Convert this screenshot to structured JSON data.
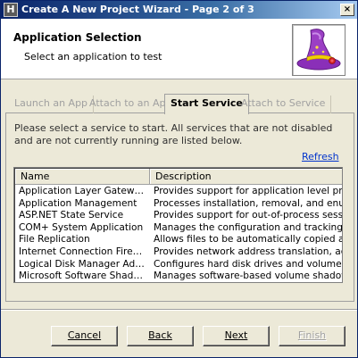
{
  "window": {
    "title": "Create A New Project Wizard - Page 2 of 3",
    "app_icon": "H",
    "close_label": "×"
  },
  "header": {
    "title": "Application Selection",
    "subtitle": "Select an application to test"
  },
  "tabs": [
    {
      "label": "Launch an App",
      "active": false
    },
    {
      "label": "Attach to an App",
      "active": false
    },
    {
      "label": "Start Service",
      "active": true
    },
    {
      "label": "Attach to Service",
      "active": false
    }
  ],
  "instructions": "Please select a service to start.  All services that are not disabled and are not currently running are listed below.",
  "refresh_label": "Refresh",
  "services_list": {
    "columns": [
      "Name",
      "Description"
    ],
    "rows": [
      {
        "name": "Application Layer Gateway ...",
        "description": "Provides support for application level pro"
      },
      {
        "name": "Application Management",
        "description": "Processes installation, removal, and enur"
      },
      {
        "name": "ASP.NET State Service",
        "description": "Provides support for out-of-process sess"
      },
      {
        "name": "COM+ System Application",
        "description": "Manages the configuration and tracking o"
      },
      {
        "name": "File Replication",
        "description": "Allows files to be automatically copied an"
      },
      {
        "name": "Internet Connection Firewa...",
        "description": "Provides network address translation, ad"
      },
      {
        "name": "Logical Disk Manager Admin...",
        "description": "Configures hard disk drives and volumes."
      },
      {
        "name": "Microsoft Software Shadow ...",
        "description": "Manages software-based volume shadow"
      }
    ]
  },
  "buttons": {
    "cancel": "Cancel",
    "back": "Back",
    "next": "Next",
    "finish": "Finish"
  },
  "colors": {
    "title_bar": "#0a246a",
    "link": "#0033cc",
    "face": "#ece9d8"
  }
}
